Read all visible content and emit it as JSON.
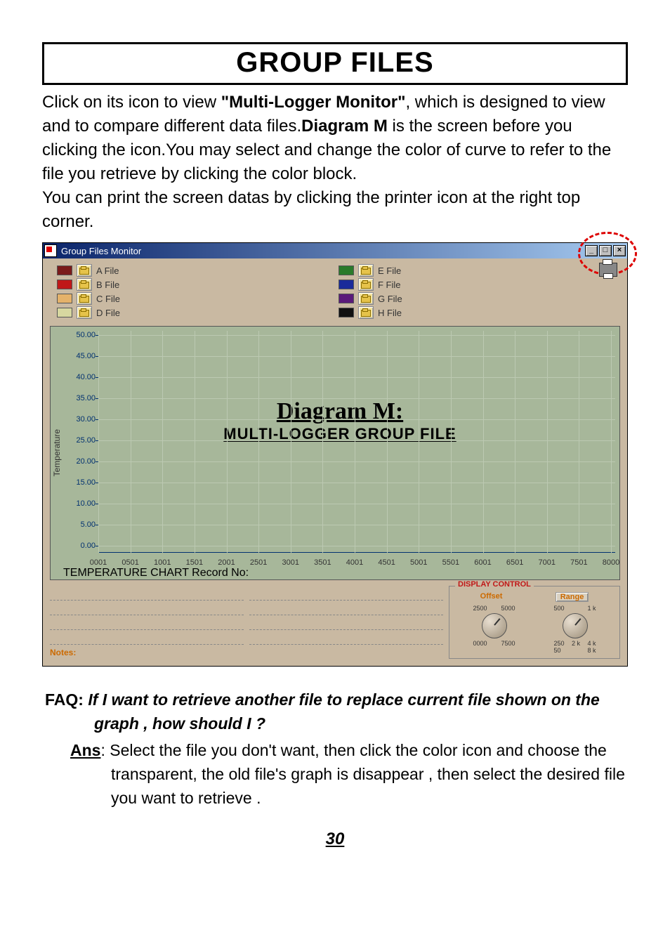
{
  "page": {
    "title": "GROUP FILES",
    "paragraph_pre": "Click on its icon to view ",
    "paragraph_bold1": "\"Multi-Logger Monitor\"",
    "paragraph_mid1": ", which is designed to view and to compare different data files.",
    "paragraph_bold2": "Diagram M",
    "paragraph_mid2": " is the screen before you clicking the icon.You may select and change the color of curve to refer to the file you retrieve by clicking the color block.",
    "paragraph_line2": "You can print the screen datas by clicking the printer icon at the right top corner.",
    "page_number": "30"
  },
  "window": {
    "title": "Group Files Monitor",
    "min": "_",
    "max": "□",
    "close": "×"
  },
  "files_left": [
    {
      "label": "A File",
      "color": "#7a1a1a"
    },
    {
      "label": "B File",
      "color": "#c01818"
    },
    {
      "label": "C File",
      "color": "#e5b26a"
    },
    {
      "label": "D File",
      "color": "#d7d7a0"
    }
  ],
  "files_right": [
    {
      "label": "E File",
      "color": "#2a7a2a"
    },
    {
      "label": "F File",
      "color": "#1a2a9a"
    },
    {
      "label": "G File",
      "color": "#5a1a7a"
    },
    {
      "label": "H File",
      "color": "#111111"
    }
  ],
  "chart_data": {
    "type": "line",
    "title": "TEMPERATURE CHART",
    "overlay_title": "Diagram M:",
    "overlay_sub": "MULTI-LOGGER GROUP FILE",
    "xlabel": "Record No:",
    "ylabel": "Temperature",
    "ylim": [
      0,
      50
    ],
    "yticks": [
      "50.00",
      "45.00",
      "40.00",
      "35.00",
      "30.00",
      "25.00",
      "20.00",
      "15.00",
      "10.00",
      "5.00",
      "0.00"
    ],
    "xticks": [
      "0001",
      "0501",
      "1001",
      "1501",
      "2001",
      "2501",
      "3001",
      "3501",
      "4001",
      "4501",
      "5001",
      "5501",
      "6001",
      "6501",
      "7001",
      "7501",
      "8000"
    ],
    "series": []
  },
  "display_control": {
    "title": "DISPLAY CONTROL",
    "offset_label": "Offset",
    "range_label": "Range",
    "offset_ticks": {
      "t1": "2500",
      "t2": "5000",
      "b1": "0000",
      "b2": "7500"
    },
    "range_ticks": {
      "t1": "500",
      "t2": "1 k",
      "m": "2 k",
      "b2": "4 k",
      "b1": "250",
      "min": "50",
      "max": "8 k"
    }
  },
  "notes_label": "Notes:",
  "faq": {
    "label": "FAQ:",
    "question": "If I want to retrieve another file to replace current file shown on the graph , how should I ?",
    "ans_label": "Ans",
    "answer": ": Select the file you don't want, then click the color icon and choose the transparent, the old file's graph is disappear , then select the desired file you want to retrieve ."
  }
}
